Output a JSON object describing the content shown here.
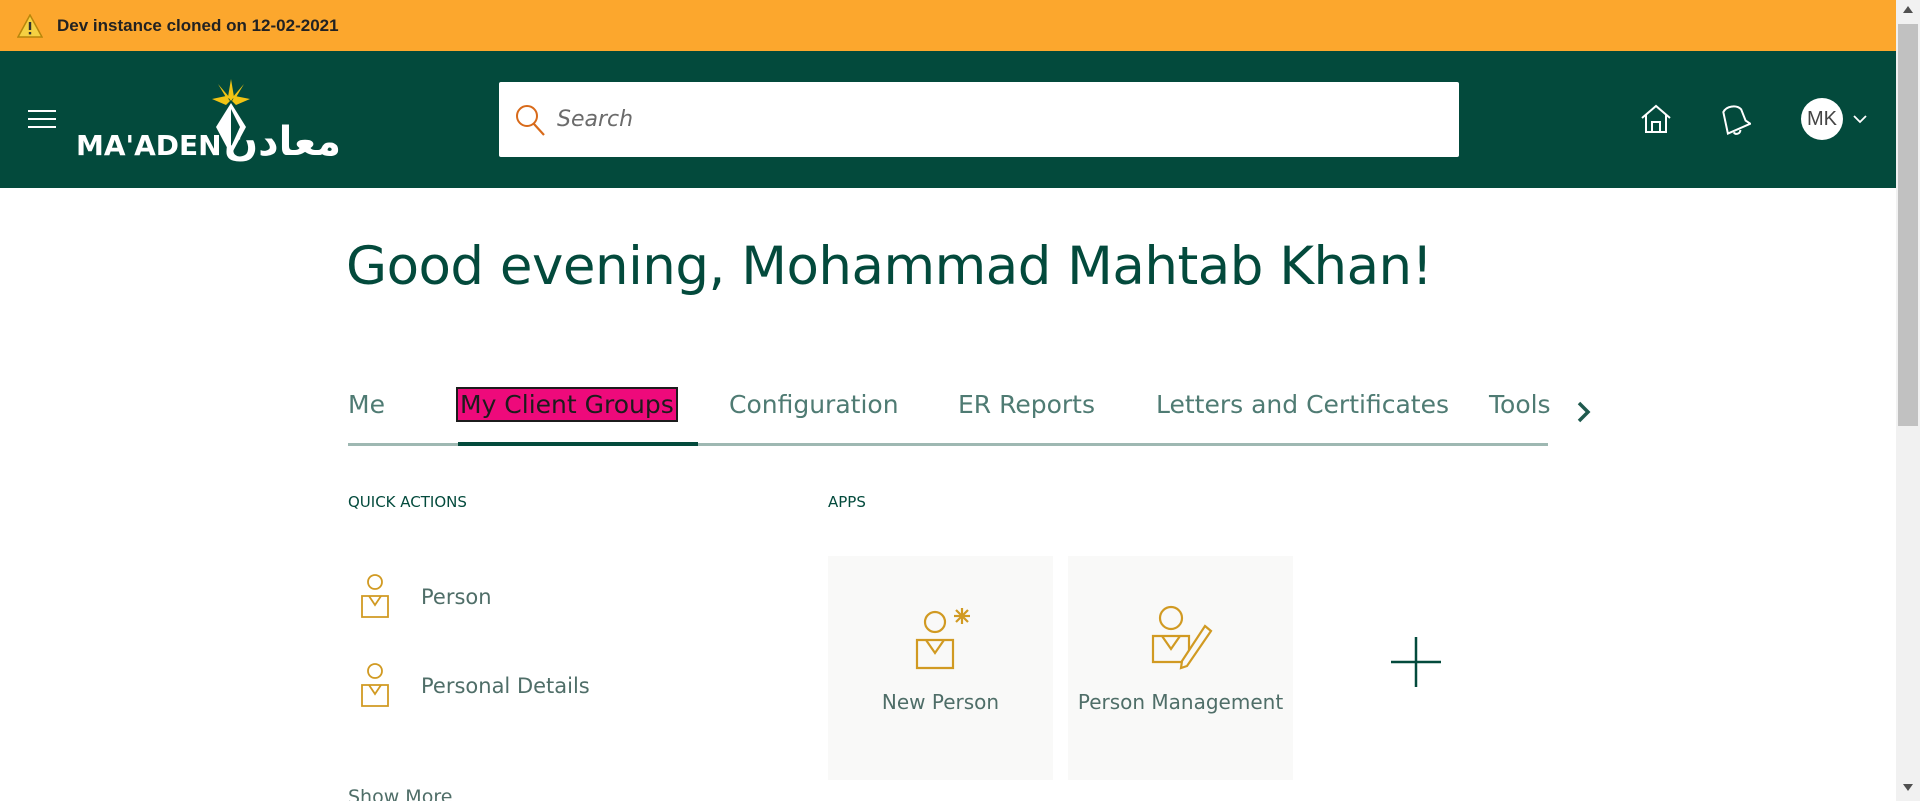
{
  "banner": {
    "text": "Dev instance cloned on 12-02-2021",
    "icon": "warning-icon"
  },
  "header": {
    "menu_icon": "hamburger-menu-icon",
    "logo_text": "MA'ADEN",
    "logo_arabic": "معادن",
    "search_placeholder": "Search",
    "home_icon": "home-icon",
    "notifications_icon": "bell-icon",
    "avatar_initials": "MK",
    "avatar_chevron": "chevron-down-icon"
  },
  "greeting": "Good evening, Mohammad Mahtab Khan!",
  "tabs": [
    {
      "label": "Me"
    },
    {
      "label": "My Client Groups",
      "active": true
    },
    {
      "label": "Configuration"
    },
    {
      "label": "ER Reports"
    },
    {
      "label": "Letters and Certificates"
    },
    {
      "label": "Tools"
    }
  ],
  "tabs_next_icon": "chevron-right-icon",
  "quick_actions": {
    "title": "QUICK ACTIONS",
    "items": [
      {
        "label": "Person",
        "icon": "person-icon"
      },
      {
        "label": "Personal Details",
        "icon": "person-icon"
      }
    ],
    "show_more": "Show More"
  },
  "apps": {
    "title": "APPS",
    "items": [
      {
        "label": "New Person",
        "icon": "new-person-icon"
      },
      {
        "label": "Person Management",
        "icon": "person-edit-icon"
      }
    ],
    "add_icon": "plus-icon"
  },
  "colors": {
    "banner": "#fca72d",
    "header": "#034a3c",
    "accent_gold": "#d19a22",
    "active_tab_highlight": "#ee0a7b"
  }
}
